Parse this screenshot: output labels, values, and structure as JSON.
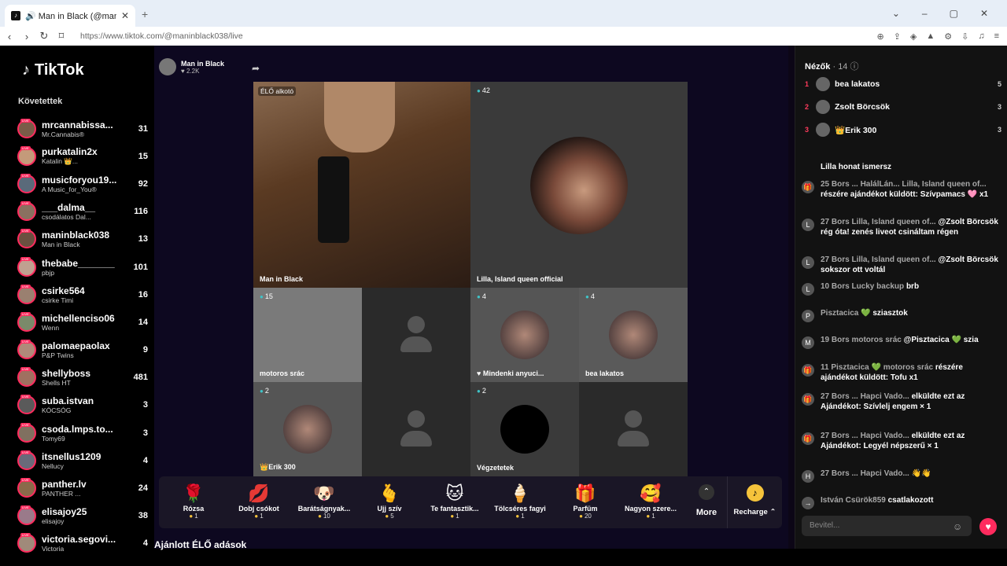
{
  "browser": {
    "tab_title": "🔊 Man in Black (@maninbl…",
    "tab_close": "✕",
    "new_tab": "+",
    "url": "https://www.tiktok.com/@maninblack038/live"
  },
  "sidebar": {
    "logo": "TikTok",
    "following_label": "Követettek",
    "items": [
      {
        "name": "mrcannabissa...",
        "sub": "Mr.Cannabis®",
        "count": "31"
      },
      {
        "name": "purkatalin2x",
        "sub": "Katalin 👑...",
        "count": "15"
      },
      {
        "name": "musicforyou19...",
        "sub": "A Music_for_You®",
        "count": "92"
      },
      {
        "name": "___dalma__",
        "sub": "csodálatos Dal...",
        "count": "116"
      },
      {
        "name": "maninblack038",
        "sub": "Man in Black",
        "count": "13"
      },
      {
        "name": "thebabe_______",
        "sub": "pbjp",
        "count": "101"
      },
      {
        "name": "csirke564",
        "sub": "csirke Timi",
        "count": "16"
      },
      {
        "name": "michellenciso06",
        "sub": "Wenn",
        "count": "14"
      },
      {
        "name": "palomaepaolax",
        "sub": "P&P Twins",
        "count": "9"
      },
      {
        "name": "shellyboss",
        "sub": "Shells HT",
        "count": "481"
      },
      {
        "name": "suba.istvan",
        "sub": "KÓCSÓG",
        "count": "3"
      },
      {
        "name": "csoda.lmps.to...",
        "sub": "Tomy69",
        "count": "3"
      },
      {
        "name": "itsnellus1209",
        "sub": "Nellucy",
        "count": "4"
      },
      {
        "name": "panther.lv",
        "sub": "PANTHER ...",
        "count": "24"
      },
      {
        "name": "elisajoy25",
        "sub": "elisajoy",
        "count": "38"
      },
      {
        "name": "victoria.segovi...",
        "sub": "Victoria",
        "count": "4"
      }
    ]
  },
  "host": {
    "name": "Man in Black",
    "likes": "♥ 2.2K"
  },
  "grid": {
    "main_label": "ÉLŐ alkotó",
    "main_name": "Man in Black",
    "lilla_count": "42",
    "lilla_name": "Lilla, Island queen official",
    "cells": [
      {
        "count": "15",
        "name": "motoros srác"
      },
      {
        "count": "",
        "name": ""
      },
      {
        "count": "4",
        "name": "♥ Mindenki anyuci..."
      },
      {
        "count": "4",
        "name": "bea lakatos"
      },
      {
        "count": "2",
        "name": "👑Erik 300"
      },
      {
        "count": "",
        "name": ""
      },
      {
        "count": "2",
        "name": "Végzetetek"
      },
      {
        "count": "",
        "name": ""
      }
    ]
  },
  "gifts": [
    {
      "icon": "🌹",
      "name": "Rózsa",
      "price": "1"
    },
    {
      "icon": "💋",
      "name": "Dobj csókot",
      "price": "1"
    },
    {
      "icon": "🐶",
      "name": "Barátságnyak...",
      "price": "10"
    },
    {
      "icon": "🫰",
      "name": "Ujj szív",
      "price": "5"
    },
    {
      "icon": "🐱",
      "name": "Te fantasztik...",
      "price": "1"
    },
    {
      "icon": "🍦",
      "name": "Tölcséres fagyi",
      "price": "1"
    },
    {
      "icon": "🎁",
      "name": "Parfüm",
      "price": "20"
    },
    {
      "icon": "🥰",
      "name": "Nagyon szere...",
      "price": "1"
    }
  ],
  "more_label": "More",
  "recharge_label": "Recharge ⌃",
  "recommended_label": "Ajánlott ÉLŐ adások",
  "viewers": {
    "title": "Nézők",
    "count": "· 14",
    "list": [
      {
        "rank": "1",
        "name": "bea lakatos",
        "score": "5"
      },
      {
        "rank": "2",
        "name": "Zsolt Börcsök",
        "score": "3"
      },
      {
        "rank": "3",
        "name": "👑Erik 300",
        "score": "3"
      }
    ]
  },
  "chat": [
    {
      "user": "",
      "text": "Lilla honat ismersz"
    },
    {
      "user": "25 Bors ... HalálLán... Lilla, Island queen of...",
      "text": "részére ajándékot küldött: Szívpamacs 🩷 x1"
    },
    {
      "user": "27 Bors Lilla, Island queen of...",
      "text": "@Zsolt Börcsök rég óta! zenés liveot csináltam régen"
    },
    {
      "user": "27 Bors Lilla, Island queen of...",
      "text": "@Zsolt Börcsök sokszor ott voltál"
    },
    {
      "user": "10 Bors Lucky backup",
      "text": "brb"
    },
    {
      "user": "Pisztacica 💚",
      "text": "sziasztok"
    },
    {
      "user": "19 Bors motoros srác",
      "text": "@Pisztacica 💚 szia"
    },
    {
      "user": "11 Pisztacica 💚 motoros srác",
      "text": "részére ajándékot küldött: Tofu x1"
    },
    {
      "user": "27 Bors ... Hapci Vado...",
      "text": "elküldte ezt az Ajándékot: Szívlelj engem × 1"
    },
    {
      "user": "27 Bors ... Hapci Vado...",
      "text": "elküldte ezt az Ajándékot: Legyél népszerű × 1"
    },
    {
      "user": "27 Bors ... Hapci Vado...",
      "text": "👋👋"
    },
    {
      "user": "István Csürök859",
      "text": "csatlakozott"
    }
  ],
  "input_placeholder": "Bevitel..."
}
